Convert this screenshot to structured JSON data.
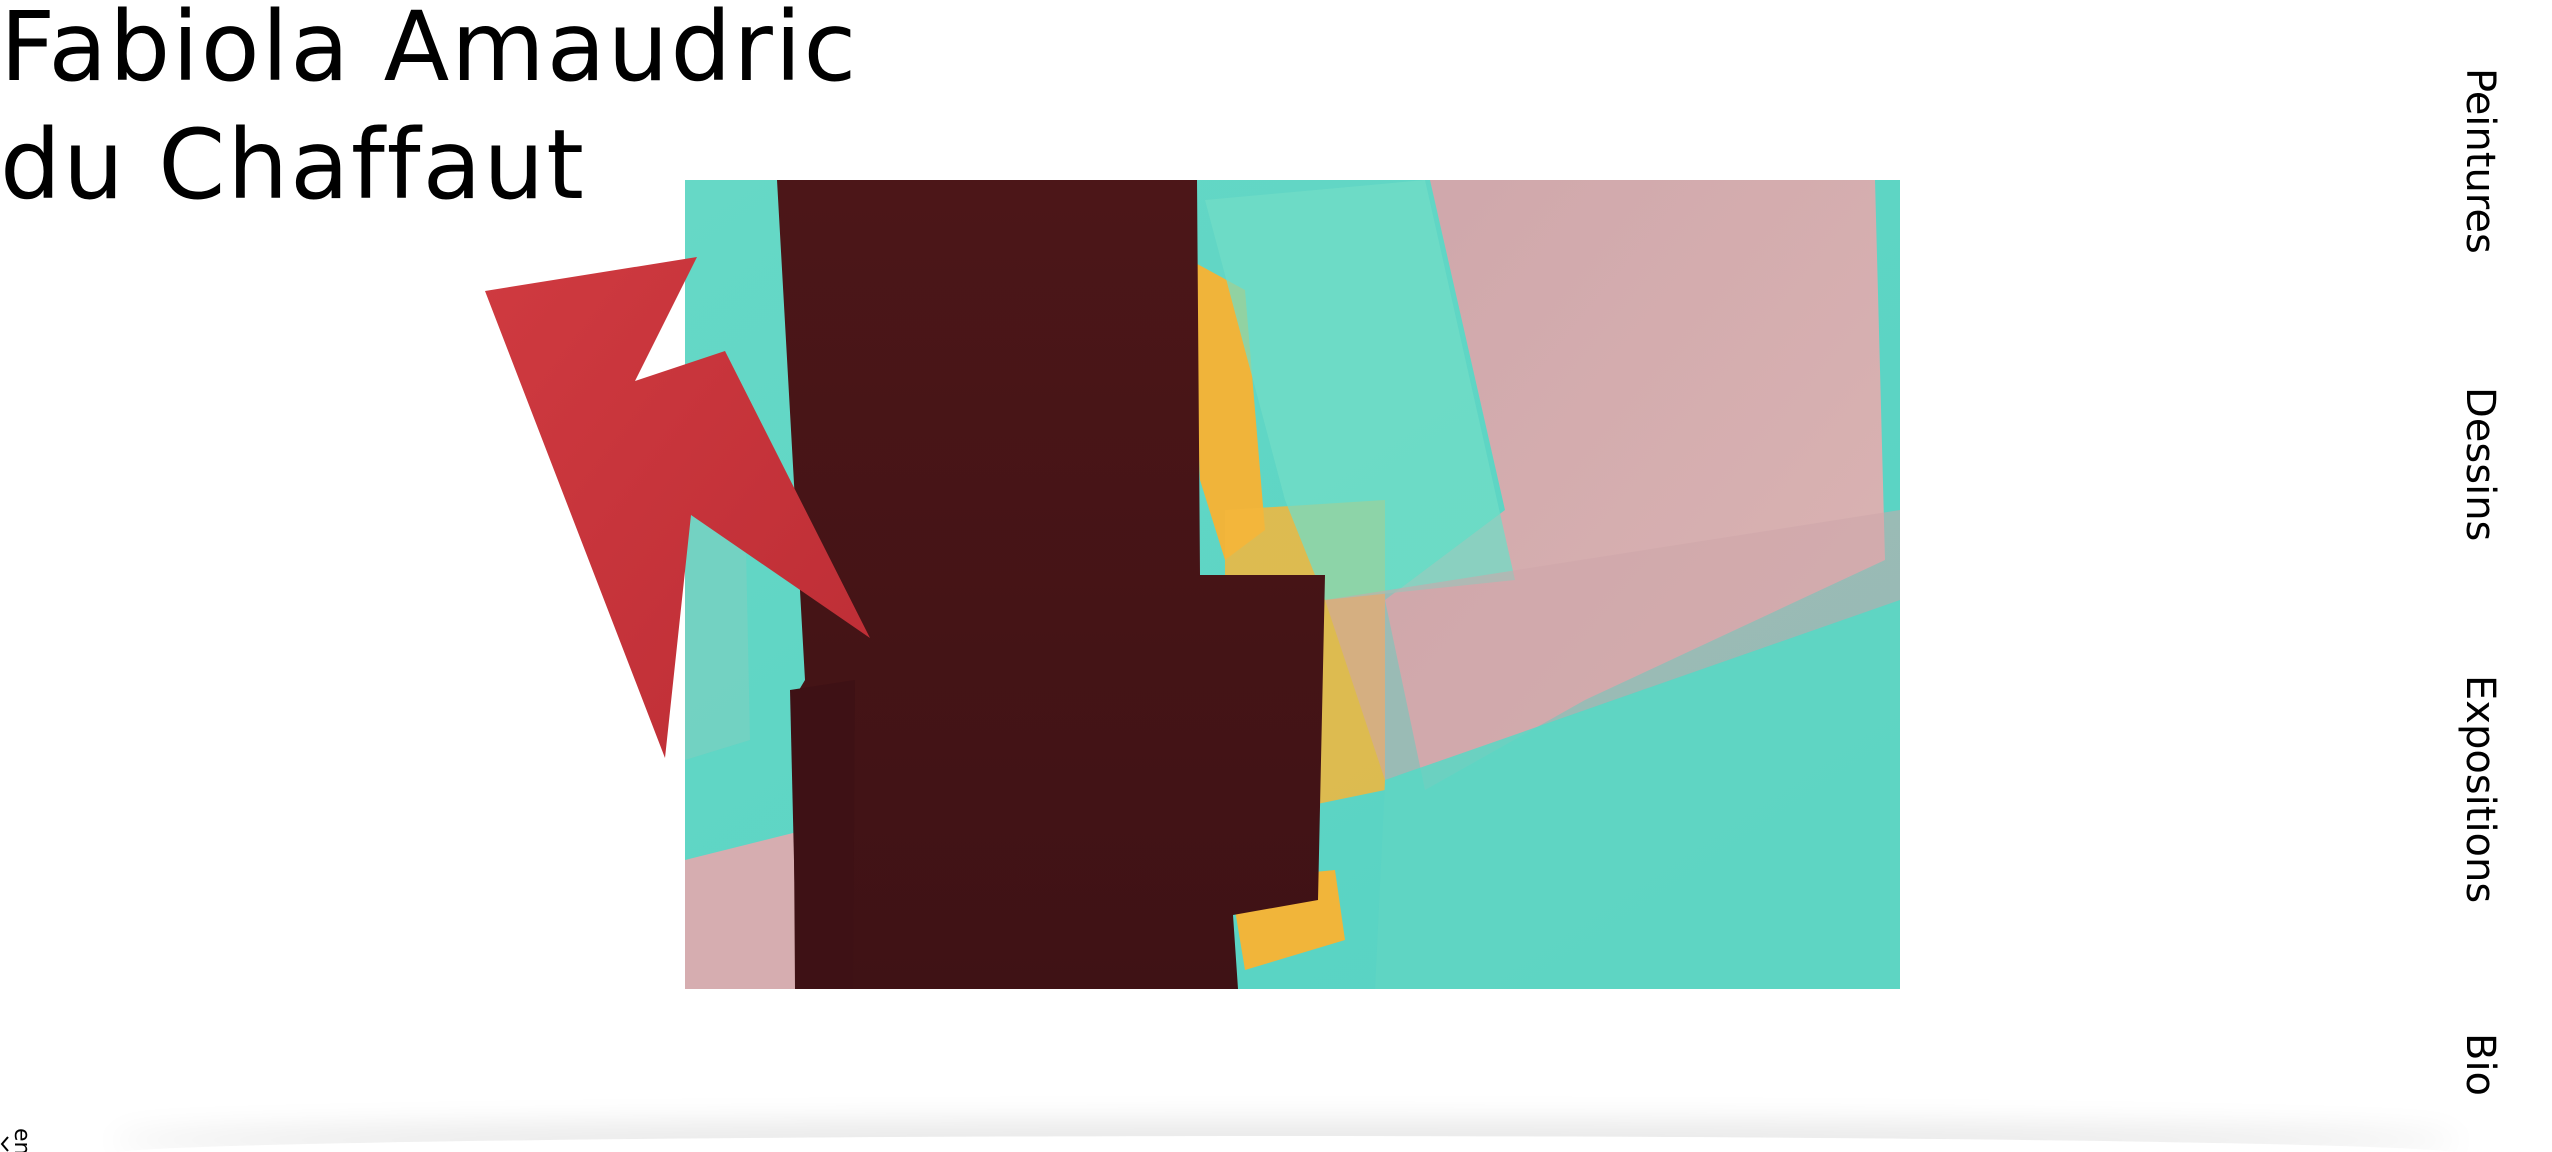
{
  "site": {
    "title_line1": "Fabiola Amaudric",
    "title_line2": "du Chaffaut"
  },
  "nav": {
    "items": [
      {
        "label": "Peintures"
      },
      {
        "label": "Dessins"
      },
      {
        "label": "Expositions"
      },
      {
        "label": "Bio"
      }
    ]
  },
  "language": {
    "label": "en"
  },
  "icons": {
    "bolt": "lightning-bolt-icon",
    "lang_arrow": "arrow-icon"
  },
  "colors": {
    "bolt": "#c9323a",
    "painting_teal": "#5fd6c4",
    "painting_maroon": "#4a1518",
    "painting_pink": "#d7aeb0",
    "painting_yellow": "#f2b23a"
  }
}
